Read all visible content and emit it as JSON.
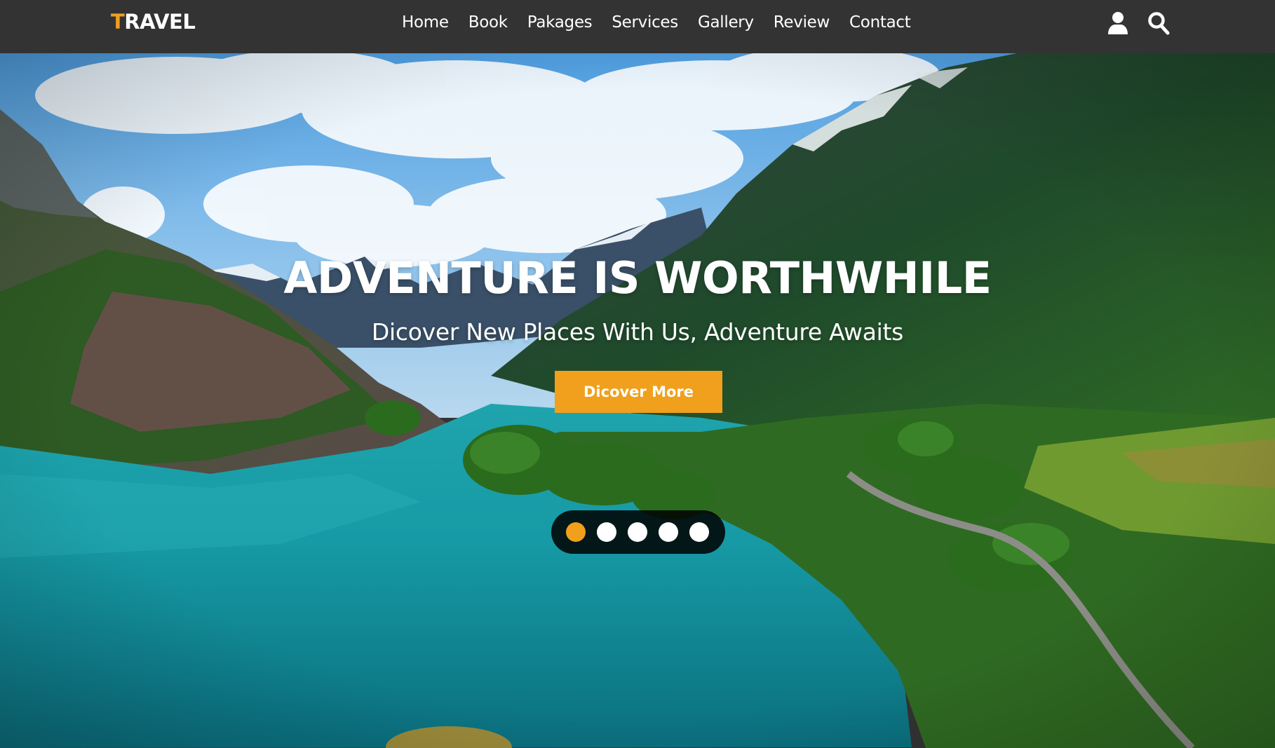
{
  "brand": {
    "first_letter": "T",
    "rest": "RAVEL"
  },
  "nav": {
    "links": [
      "Home",
      "Book",
      "Pakages",
      "Services",
      "Gallery",
      "Review",
      "Contact"
    ],
    "icons": [
      "user-icon",
      "search-icon"
    ]
  },
  "hero": {
    "title": "ADVENTURE IS WORTHWHILE",
    "subtitle": "Dicover New Places With Us, Adventure Awaits",
    "cta_label": "Dicover More",
    "slides": {
      "count": 5,
      "active_index": 0
    }
  },
  "colors": {
    "accent": "#f0a01c",
    "navbar": "#333333",
    "text": "#ffffff"
  }
}
